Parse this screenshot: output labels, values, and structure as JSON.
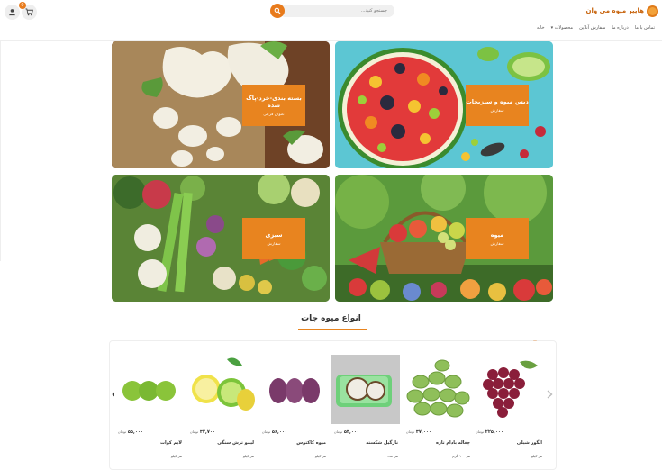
{
  "header": {
    "brand_name": "هایپر میوه می وان",
    "search_placeholder": "جستجو کنید...",
    "cart_count": "0",
    "nav": [
      "خانه",
      "محصولات ▾",
      "سفارش آنلاین",
      "درباره ما",
      "تماس با ما"
    ]
  },
  "banners": [
    {
      "title": "دیس میوه و سبزیجات",
      "subtitle": "سفارش"
    },
    {
      "title": "بسته بندی-خرد-پاک شده",
      "subtitle": "عنوان فرعی"
    },
    {
      "title": "میوه",
      "subtitle": "سفارش"
    },
    {
      "title": "سبزی",
      "subtitle": "سفارش"
    }
  ],
  "section": {
    "title": "انواع میوه جات"
  },
  "currency": "تومان",
  "products": [
    {
      "name": "انگور شیلی",
      "price": "۲۲۵,۰۰۰",
      "unit": "هر کیلو"
    },
    {
      "name": "چغاله بادام تازه",
      "price": "۳۷,۰۰۰",
      "unit": "هر ۱۰۰ گرم"
    },
    {
      "name": "نارگیل شکسته",
      "price": "۵۳,۰۰۰",
      "unit": "هر عدد"
    },
    {
      "name": "میوه کاکتوس",
      "price": "۵۶,۰۰۰",
      "unit": "هر کیلو"
    },
    {
      "name": "لیمو ترش سنگی",
      "price": "۳۲,۷۰۰",
      "unit": "هر کیلو"
    },
    {
      "name": "لایم کوات",
      "price": "۵۵,۰۰۰",
      "unit": "هر کیلو"
    }
  ],
  "colors": {
    "accent": "#e8841f",
    "brand": "#c8650f"
  },
  "icons": {
    "cart": "cart-icon",
    "user": "user-icon",
    "search": "search-icon",
    "prev": "chevron-left-icon",
    "next": "chevron-right-icon"
  }
}
